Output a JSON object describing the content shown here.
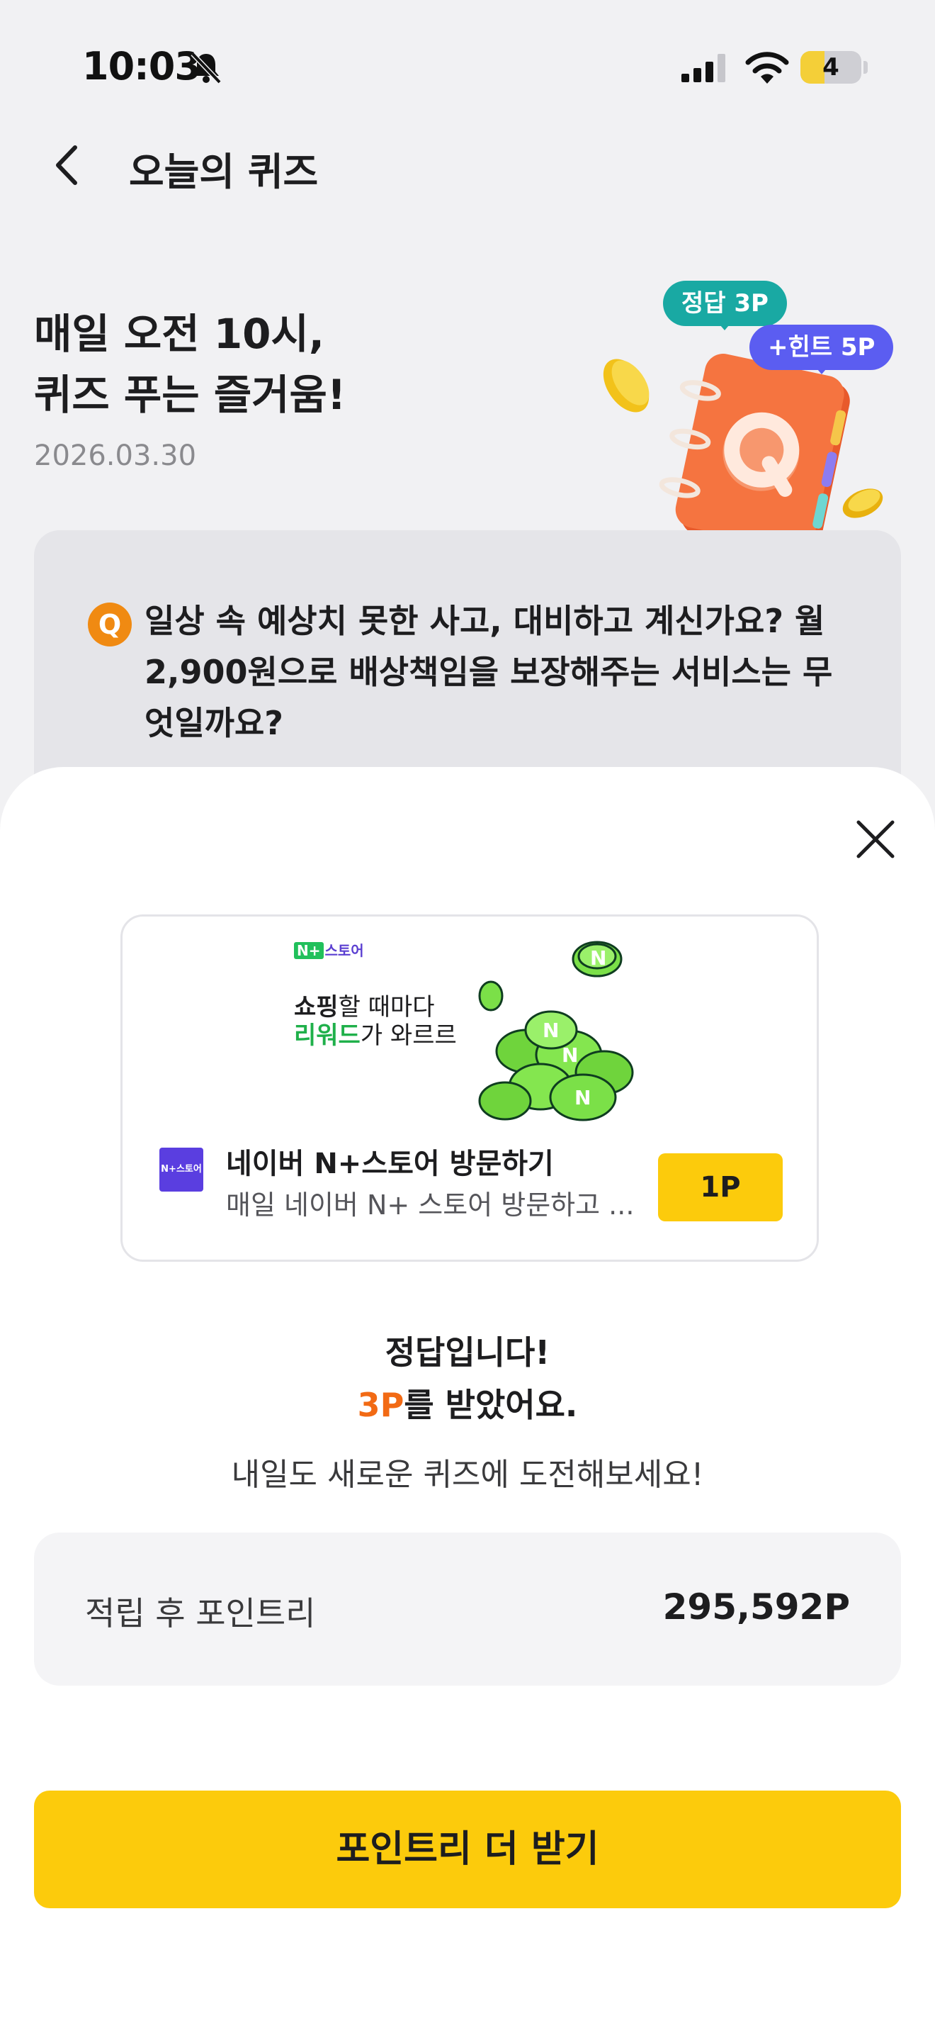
{
  "status_bar": {
    "time": "10:03",
    "battery": "4",
    "battery_level": 0.4
  },
  "nav": {
    "title": "오늘의 퀴즈"
  },
  "hero": {
    "title_line1": "매일 오전 10시,",
    "title_line2": "퀴즈 푸는 즐거움!",
    "date": "2026.03.30",
    "badge_correct": "정답 3P",
    "badge_hint": "+힌트 5P"
  },
  "question": {
    "icon": "Q",
    "text": "일상 속 예상치 못한 사고, 대비하고 계신가요? 월 2,900원으로 배상책임을 보장해주는 서비스는 무엇일까요?"
  },
  "ad": {
    "brand_chip": "N+",
    "brand_name": "스토어",
    "banner_line1_strong": "쇼핑",
    "banner_line1_rest": "할 때마다",
    "banner_line2_green": "리워드",
    "banner_line2_rest": "가 와르르",
    "logo_text": "N+스토어",
    "title": "네이버 N+스토어 방문하기",
    "desc": "매일 네이버 N+ 스토어 방문하고 ...",
    "reward": "1P"
  },
  "result": {
    "line1": "정답입니다!",
    "points_earned": "3P",
    "line2_suffix": "를 받았어요.",
    "sub": "내일도 새로운 퀴즈에 도전해보세요!"
  },
  "balance": {
    "label": "적립 후 포인트리",
    "value": "295,592P"
  },
  "cta": {
    "label": "포인트리 더 받기"
  },
  "colors": {
    "accent_yellow": "#fccb0c",
    "orange": "#f26a14",
    "teal": "#19a9a3",
    "purple": "#5b5df1"
  }
}
